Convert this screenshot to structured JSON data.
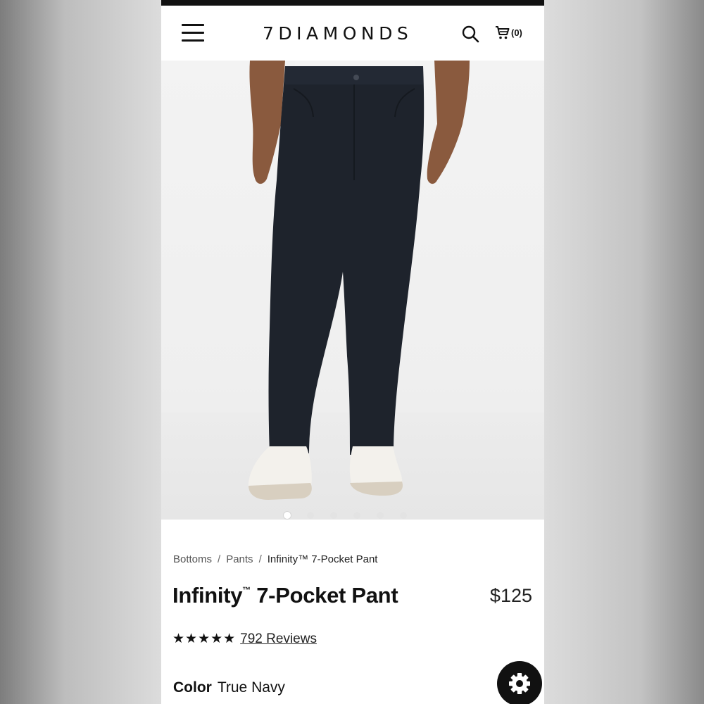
{
  "header": {
    "logo": "7DIAMONDS",
    "cart_count": "(0)"
  },
  "gallery": {
    "slide_count": 6,
    "active_slide": 1
  },
  "breadcrumb": {
    "items": [
      "Bottoms",
      "Pants",
      "Infinity™ 7-Pocket Pant"
    ],
    "separator": "/"
  },
  "product": {
    "title_main": "Infinity",
    "title_tm": "™",
    "title_rest": "7-Pocket Pant",
    "price": "$125",
    "stars": "★★★★★",
    "rating": 5,
    "reviews": "792 Reviews",
    "color_label": "Color",
    "color_value": "True Navy"
  },
  "colors": {
    "pants": "#1e232c",
    "background": "#f1f1f1",
    "text": "#111111"
  }
}
